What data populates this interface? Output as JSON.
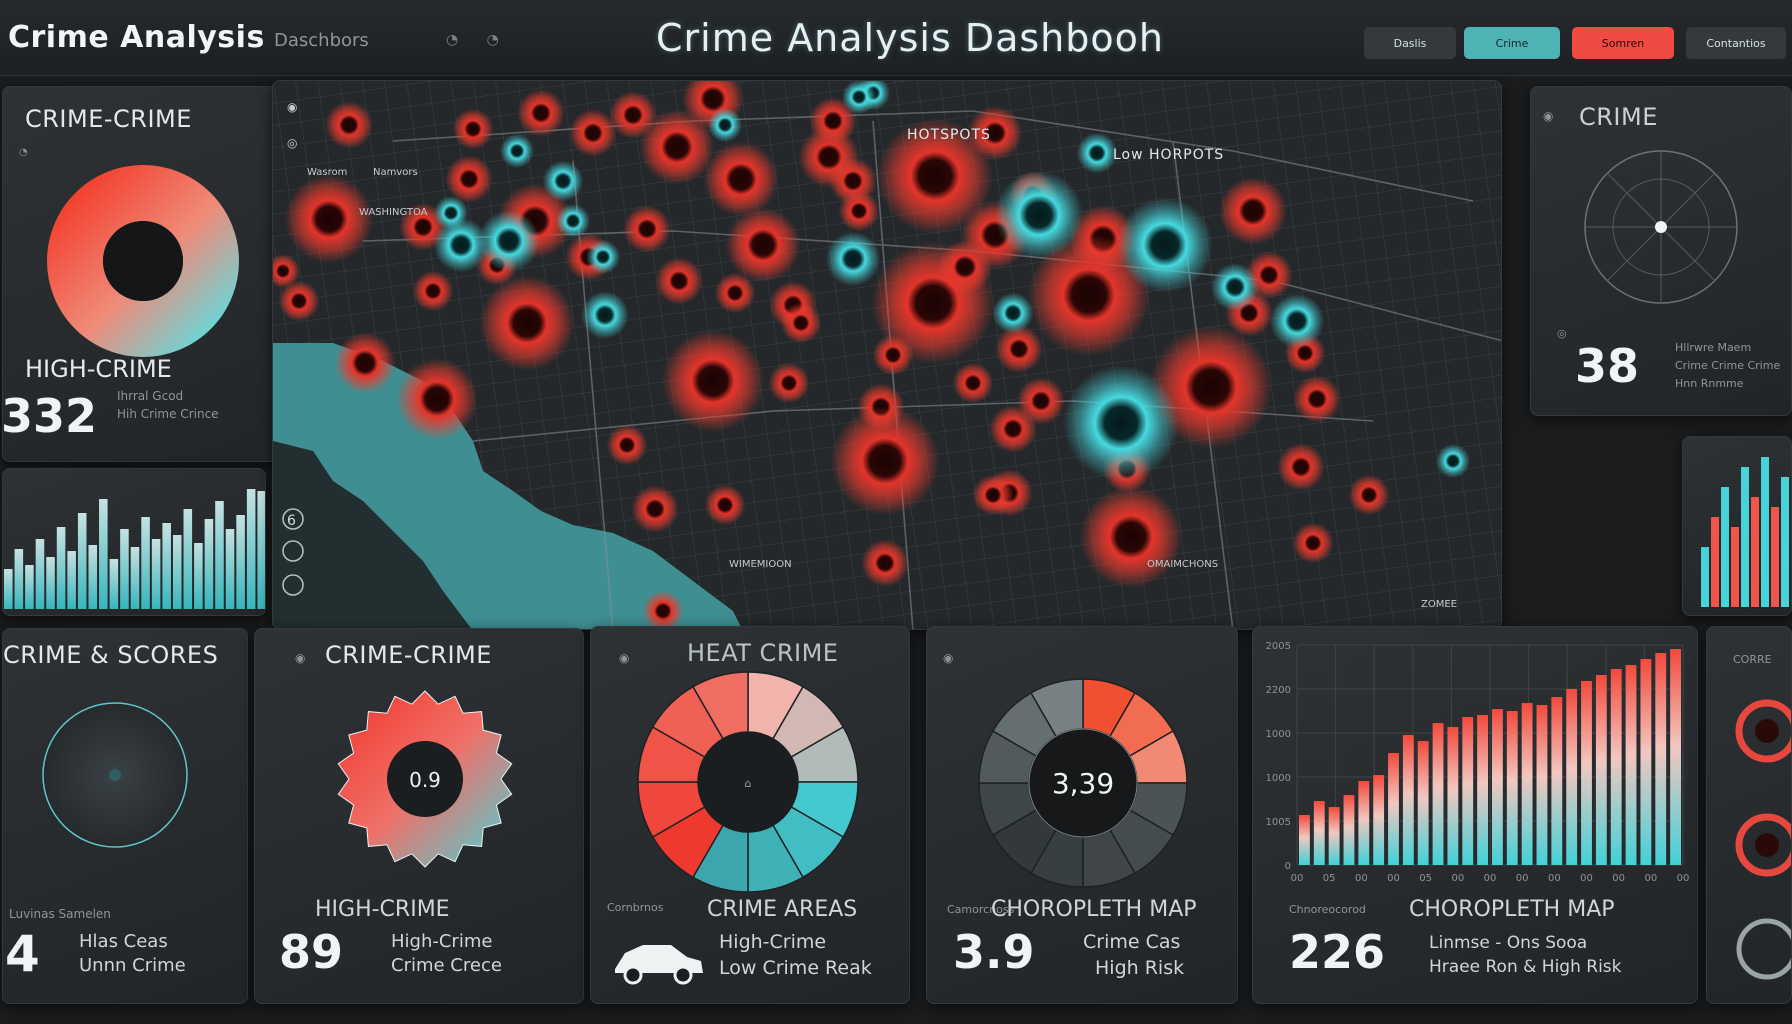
{
  "header": {
    "app_title": "Crime Analysis",
    "app_subtitle": "Daschbors",
    "app_subicons": "◔ ◔",
    "main_title": "Crime Analysis Dashbooh",
    "buttons": [
      {
        "label": "Daslis",
        "color": "#33393c"
      },
      {
        "label": "Crime",
        "color": "#4fb3b6"
      },
      {
        "label": "Somren",
        "color": "#ef4b43"
      },
      {
        "label": "Contantios",
        "color": "#33393c"
      }
    ]
  },
  "left_top_panel": {
    "title": "CRIME-CRIME",
    "stat_label": "HIGH-CRIME",
    "stat_value": "332",
    "stat_note_1": "Ihrral Gcod",
    "stat_note_2": "Hih Crime Crince"
  },
  "map": {
    "label_hotspots": "HOTSPOTS",
    "label_low_hotspots": "Low HORPOTS",
    "label_top_left_1": "Wasrom",
    "label_top_left_2": "Namvors",
    "label_district": "WASHINGTOA",
    "label_bottom": "WIMEMIOON",
    "label_right": "OMAIMCHONS",
    "label_far_right": "ZOMEE",
    "zoom_level": "6"
  },
  "right_top_panel": {
    "title": "CRIME",
    "stat_value": "38",
    "note_1": "Hllrwre Maem",
    "note_2": "Crime Crime Crime",
    "note_3": "Hnn Rnmme"
  },
  "bottom_panels": [
    {
      "title": "CRIME & SCORES",
      "big": "4",
      "note_1": "Hlas Ceas",
      "note_2": "Unnn Crime",
      "foot": "Luvinas Samelen"
    },
    {
      "title": "CRIME-CRIME",
      "center": "0.9",
      "stat_label": "HIGH-CRIME",
      "big": "89",
      "note_1": "High-Crime",
      "note_2": "Crime Crece"
    },
    {
      "title": "HEAT CRIME",
      "stat_label": "CRIME AREAS",
      "note_1": "High-Crime",
      "note_2": "Low Crime Reak",
      "foot": "Cornbrnos"
    },
    {
      "title": "",
      "center": "3,39",
      "stat_label": "CHOROPLETH MAP",
      "big": "3.9",
      "note_1": "Crime Cas",
      "note_2": "High Risk",
      "foot": "Camorcnoss"
    },
    {
      "title": "",
      "stat_label": "CHOROPLETH MAP",
      "big": "226",
      "note_1": "Linmse - Ons Sooa",
      "note_2": "Hraee Ron & High Risk",
      "foot": "Chnoreocorod"
    },
    {
      "title": "CORRE"
    }
  ],
  "ticks": {
    "chart_y": [
      "2005",
      "2200",
      "1000",
      "1000",
      "1005",
      "0"
    ],
    "chart_x": [
      "00",
      "05",
      "00",
      "00",
      "05",
      "00",
      "00",
      "00",
      "00",
      "00",
      "00",
      "00",
      "00"
    ]
  },
  "colors": {
    "red": "#ef3b30",
    "teal": "#3fd4d8",
    "panel": "#2a2e31"
  }
}
